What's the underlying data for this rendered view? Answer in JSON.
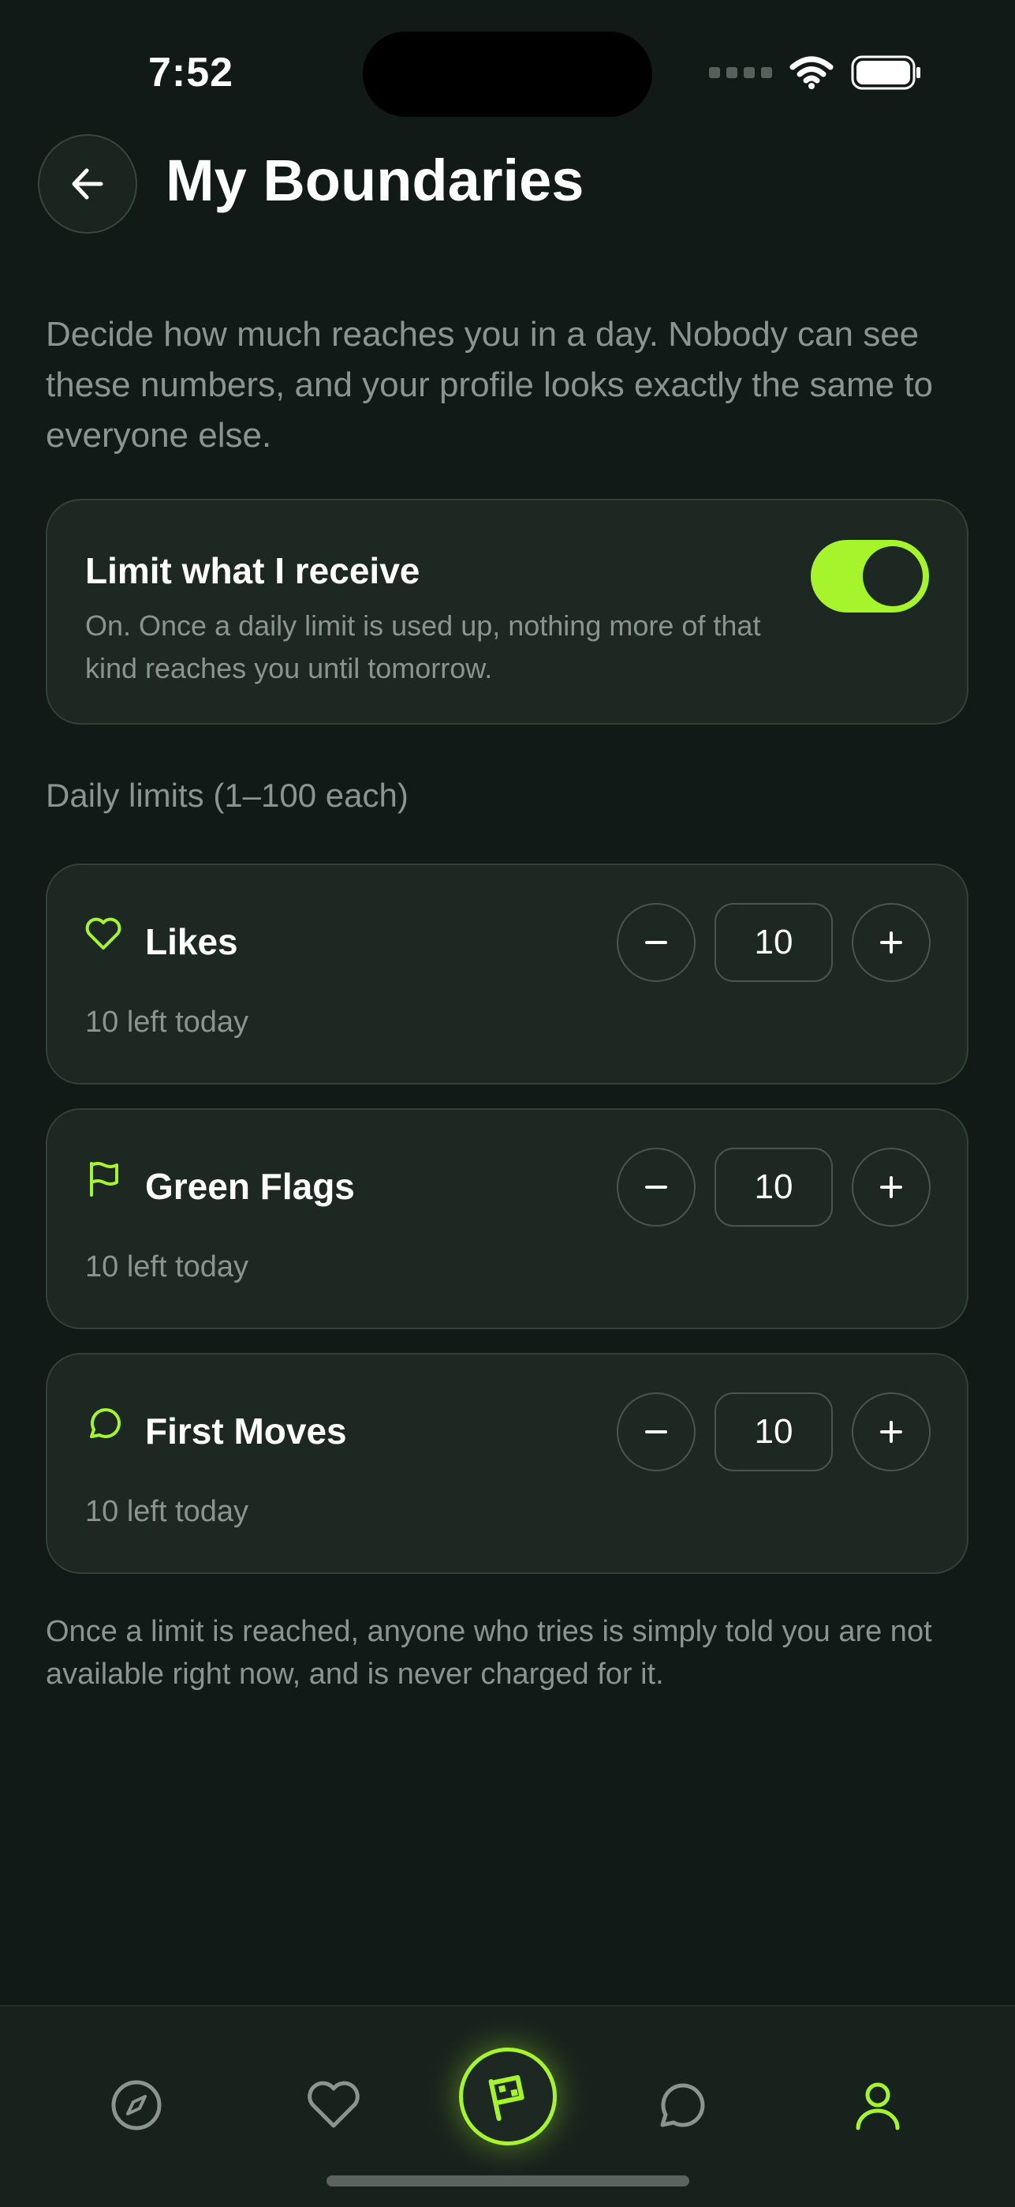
{
  "status_bar": {
    "time": "7:52"
  },
  "header": {
    "title": "My Boundaries"
  },
  "intro": "Decide how much reaches you in a day. Nobody can see these numbers, and your profile looks exactly the same to everyone else.",
  "limit_toggle": {
    "title": "Limit what I receive",
    "description": "On. Once a daily limit is used up, nothing more of that kind reaches you until tomorrow.",
    "enabled": true
  },
  "section_label": "Daily limits (1–100 each)",
  "limits": [
    {
      "icon": "heart-icon",
      "title": "Likes",
      "value": "10",
      "remaining": "10 left today"
    },
    {
      "icon": "flag-icon",
      "title": "Green Flags",
      "value": "10",
      "remaining": "10 left today"
    },
    {
      "icon": "chat-bubble-icon",
      "title": "First Moves",
      "value": "10",
      "remaining": "10 left today"
    }
  ],
  "footnote": "Once a limit is reached, anyone who tries is simply told you are not available right now, and is never charged for it.",
  "tabs": [
    {
      "icon": "compass-icon"
    },
    {
      "icon": "heart-icon"
    },
    {
      "icon": "flag-icon"
    },
    {
      "icon": "chat-bubble-icon"
    },
    {
      "icon": "profile-icon"
    }
  ],
  "colors": {
    "accent": "#a6f52c",
    "background": "#111a16",
    "card": "#1d2823",
    "muted": "#8b9490"
  }
}
